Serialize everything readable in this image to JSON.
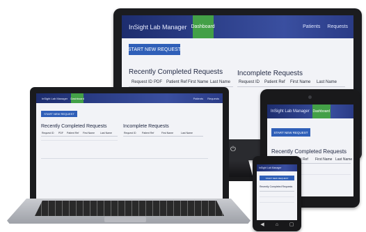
{
  "app": {
    "brand": "InSight Lab Manager",
    "dashboard_tab": "Dashboard",
    "nav_patients": "Patients",
    "nav_requests": "Requests",
    "start_button": "START NEW REQUEST",
    "recent_heading": "Recently Completed Requests",
    "incomplete_heading": "Incomplete Requests",
    "recent_columns": [
      "Request ID",
      "PDF",
      "Patient Ref",
      "First Name",
      "Last Name"
    ],
    "incomplete_columns": [
      "Request ID",
      "Patient Ref",
      "First Name",
      "Last Name"
    ]
  },
  "colors": {
    "appbar": "#1d2d6e",
    "dashboard_tab": "#43a047",
    "button": "#2f5fb8",
    "device_frame": "#1a1a1c"
  }
}
